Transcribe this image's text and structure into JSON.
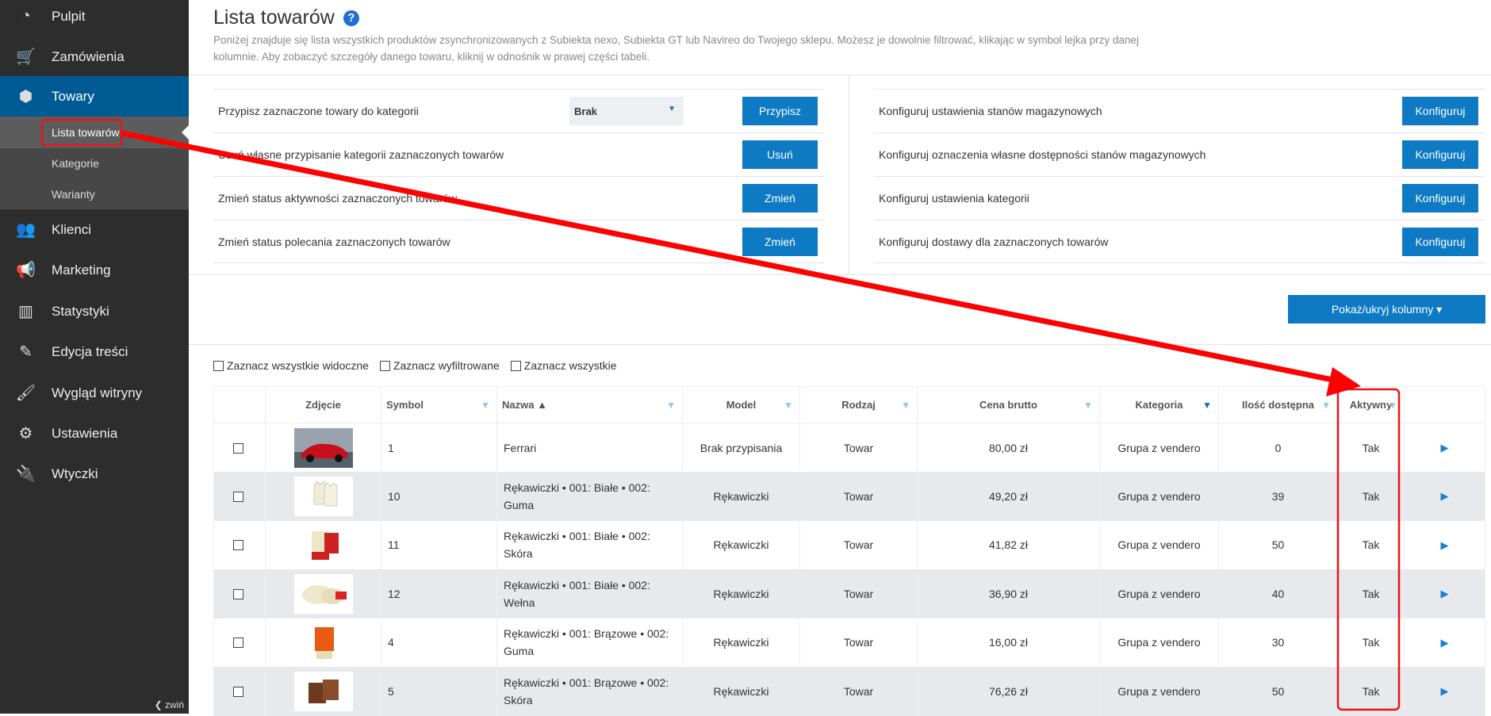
{
  "sidebar": {
    "items": [
      {
        "label": "Pulpit",
        "icon": "dashboard-icon"
      },
      {
        "label": "Zamówienia",
        "icon": "cart-icon"
      },
      {
        "label": "Towary",
        "icon": "box-icon"
      },
      {
        "label": "Klienci",
        "icon": "users-icon"
      },
      {
        "label": "Marketing",
        "icon": "megaphone-icon"
      },
      {
        "label": "Statystyki",
        "icon": "chart-icon"
      },
      {
        "label": "Edycja treści",
        "icon": "edit-icon"
      },
      {
        "label": "Wygląd witryny",
        "icon": "brush-icon"
      },
      {
        "label": "Ustawienia",
        "icon": "gears-icon"
      },
      {
        "label": "Wtyczki",
        "icon": "plug-icon"
      }
    ],
    "submenu": [
      "Lista towarów",
      "Kategorie",
      "Warianty"
    ],
    "collapse": "zwiń"
  },
  "page": {
    "title": "Lista towarów",
    "help": "?",
    "description": "Poniżej znajduje się lista wszystkich produktów zsynchronizowanych z Subiekta nexo, Subiekta GT lub Navireo do Twojego sklepu. Możesz je dowolnie filtrować, klikając w symbol lejka przy danej kolumnie. Aby zobaczyć szczegóły danego towaru, kliknij w odnośnik w prawej części tabeli."
  },
  "actions_left": [
    {
      "label": "Przypisz zaznaczone towary do kategorii",
      "button": "Przypisz",
      "select": "Brak"
    },
    {
      "label": "Usuń własne przypisanie kategorii zaznaczonych towarów",
      "button": "Usuń"
    },
    {
      "label": "Zmień status aktywności zaznaczonych towarów",
      "button": "Zmień"
    },
    {
      "label": "Zmień status polecania zaznaczonych towarów",
      "button": "Zmień"
    }
  ],
  "actions_right": [
    {
      "label": "Konfiguruj ustawienia stanów magazynowych",
      "button": "Konfiguruj"
    },
    {
      "label": "Konfiguruj oznaczenia własne dostępności stanów magazynowych",
      "button": "Konfiguruj"
    },
    {
      "label": "Konfiguruj ustawienia kategorii",
      "button": "Konfiguruj"
    },
    {
      "label": "Konfiguruj dostawy dla zaznaczonych towarów",
      "button": "Konfiguruj"
    }
  ],
  "columns_button": "Pokaż/ukryj kolumny ▾",
  "select_options": [
    "Zaznacz wszystkie widoczne",
    "Zaznacz wyfiltrowane",
    "Zaznacz wszystkie"
  ],
  "table": {
    "headers": [
      "Zdjęcie",
      "Symbol",
      "Nazwa ▲",
      "Model",
      "Rodzaj",
      "Cena brutto",
      "Kategoria",
      "Ilość dostępna",
      "Aktywny"
    ],
    "rows": [
      {
        "symbol": "1",
        "name": "Ferrari",
        "model": "Brak przypisania",
        "type": "Towar",
        "price": "80,00 zł",
        "category": "Grupa z vendero",
        "qty": "0",
        "active": "Tak"
      },
      {
        "symbol": "10",
        "name": "Rękawiczki • 001: Białe • 002: Guma",
        "model": "Rękawiczki",
        "type": "Towar",
        "price": "49,20 zł",
        "category": "Grupa z vendero",
        "qty": "39",
        "active": "Tak"
      },
      {
        "symbol": "11",
        "name": "Rękawiczki • 001: Białe • 002: Skóra",
        "model": "Rękawiczki",
        "type": "Towar",
        "price": "41,82 zł",
        "category": "Grupa z vendero",
        "qty": "50",
        "active": "Tak"
      },
      {
        "symbol": "12",
        "name": "Rękawiczki • 001: Białe • 002: Wełna",
        "model": "Rękawiczki",
        "type": "Towar",
        "price": "36,90 zł",
        "category": "Grupa z vendero",
        "qty": "40",
        "active": "Tak"
      },
      {
        "symbol": "4",
        "name": "Rękawiczki • 001: Brązowe • 002: Guma",
        "model": "Rękawiczki",
        "type": "Towar",
        "price": "16,00 zł",
        "category": "Grupa z vendero",
        "qty": "30",
        "active": "Tak"
      },
      {
        "symbol": "5",
        "name": "Rękawiczki • 001: Brązowe • 002: Skóra",
        "model": "Rękawiczki",
        "type": "Towar",
        "price": "76,26 zł",
        "category": "Grupa z vendero",
        "qty": "50",
        "active": "Tak"
      }
    ]
  },
  "colors": {
    "accent": "#0e7ac4",
    "sidebar": "#2d2d2d",
    "active_nav": "#005b94",
    "annotation": "#ff0000"
  }
}
